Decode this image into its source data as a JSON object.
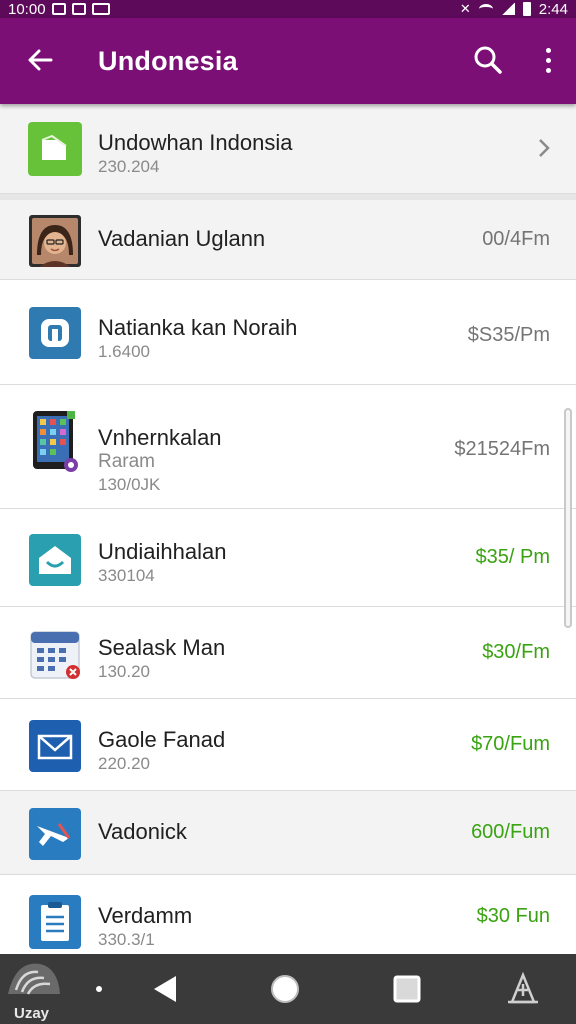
{
  "status_bar": {
    "time_left": "10:00",
    "time_right": "2:44",
    "icons": [
      "notification-box-icon",
      "sim-icon",
      "usb-icon",
      "mute-icon",
      "wifi-icon",
      "signal-icon",
      "battery-icon"
    ]
  },
  "app_bar": {
    "title": "Undonesia",
    "back_icon": "arrow-left-icon",
    "search_icon": "search-icon",
    "more_icon": "more-vert-icon"
  },
  "list": {
    "rows": [
      {
        "icon": "folder-icon",
        "title": "Undowhan Indonsia",
        "subtitle": "230.204",
        "trailing": "chevron-right-icon"
      },
      {
        "icon": "avatar",
        "title": "Vadanian Uglann",
        "price": "00/4Fm"
      },
      {
        "icon": "app-square-icon",
        "title": "Natianka kan Noraih",
        "subtitle": "1.6400",
        "price": "$S35/Pm"
      },
      {
        "icon": "tablet-icon",
        "title": "Vnhernkalan",
        "subtitle": "Raram",
        "subtitle2": "130/0JK",
        "price": "$21524Fm"
      },
      {
        "icon": "house-icon",
        "title": "Undiaihhalan",
        "subtitle": "330104",
        "price": "$35/ Pm"
      },
      {
        "icon": "calendar-icon",
        "title": "Sealask Man",
        "subtitle": "130.20",
        "price": "$30/Fm"
      },
      {
        "icon": "mail-icon",
        "title": "Gaole Fanad",
        "subtitle": "220.20",
        "price": "$70/Fum"
      },
      {
        "icon": "plane-icon",
        "title": "Vadonick",
        "price": "600/Fum"
      },
      {
        "icon": "clipboard-icon",
        "title": "Verdamm",
        "subtitle": "330.3/1",
        "price": "$30 Fun"
      }
    ]
  },
  "nav_bar": {
    "logo_text": "Uzay",
    "back_icon": "nav-back-icon",
    "home_icon": "nav-home-icon",
    "recents_icon": "nav-recents-icon",
    "extra_icon": "accessibility-icon"
  },
  "colors": {
    "app_bar": "#7b0f75",
    "status_bar": "#5d0a5a",
    "price_green": "#3aa312",
    "price_gray": "#757575",
    "nav_bar": "#3a3a3a"
  }
}
